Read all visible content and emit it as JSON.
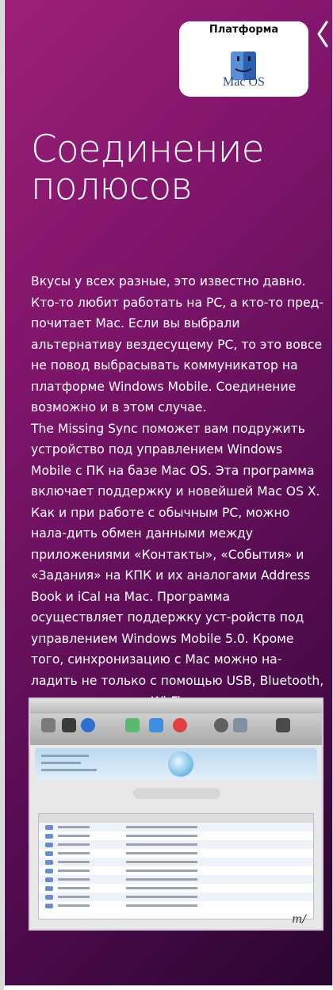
{
  "badge": {
    "label": "Платформа",
    "logo_text": "Mac OS",
    "icon": "mac-os-finder-icon"
  },
  "title": "Соединение полюсов",
  "paragraphs": [
    "Вкусы у всех разные, это известно давно. Кто-то любит работать на PC, а кто-то пред-почитает Mac. Если вы выбрали альтернативу вездесущему PC, то это вовсе не повод выбрасывать коммуникатор на платформе Windows Mobile. Соединение возможно и в этом случае.",
    "The Missing Sync поможет вам подружить устройство под управлением Windows Mobile с ПК на базе Mac OS. Эта программа включает поддержку и новейшей Mac OS X.",
    "Как и при работе с обычным PC, можно нала-дить обмен данными между приложениями «Контакты», «События» и «Задания» на КПК и их аналогами Address Book и iCal на Mac. Программа осуществляет поддержку уст-ройств под управлением Windows Mobile 5.0. Кроме того, синхронизацию с Mac можно на-ладить не только с помощью USB, Bluetooth, но и посредством Wi-Fi."
  ],
  "screenshot_mark": "m/",
  "colors": {
    "panel_top": "#9e1f7a",
    "panel_bottom": "#2a0630",
    "text": "#ffffff"
  }
}
